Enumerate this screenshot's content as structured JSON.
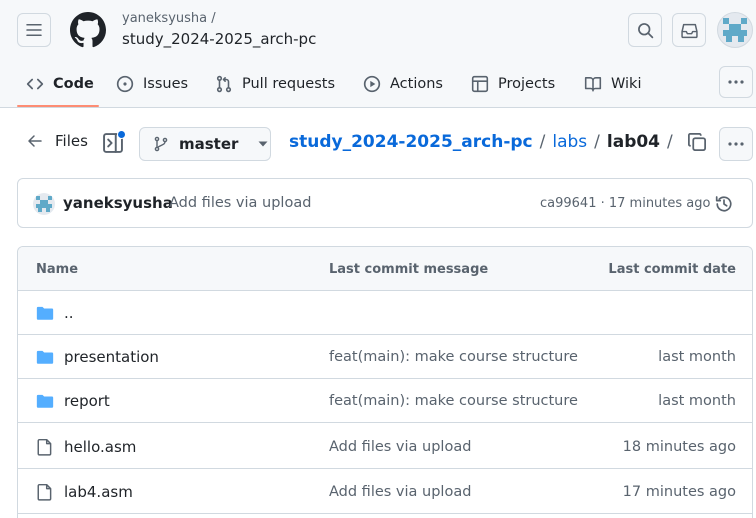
{
  "header": {
    "owner": "yaneksyusha /",
    "repo": "study_2024-2025_arch-pc",
    "menu_icon": "hamburger-icon",
    "logo_icon": "github-logo",
    "search_icon": "search-icon",
    "inbox_icon": "inbox-icon"
  },
  "nav": {
    "items": [
      {
        "label": "Code",
        "icon": "code-icon"
      },
      {
        "label": "Issues",
        "icon": "issue-opened-icon"
      },
      {
        "label": "Pull requests",
        "icon": "git-pull-request-icon"
      },
      {
        "label": "Actions",
        "icon": "play-icon"
      },
      {
        "label": "Projects",
        "icon": "table-icon"
      },
      {
        "label": "Wiki",
        "icon": "book-icon"
      }
    ],
    "active": "Code"
  },
  "path_bar": {
    "files_label": "Files",
    "branch": "master",
    "breadcrumb": {
      "repo": "study_2024-2025_arch-pc",
      "sep1": "/",
      "folder": "labs",
      "sep2": "/",
      "current": "lab04",
      "sep3": "/"
    }
  },
  "commit": {
    "author": "yaneksyusha",
    "message": "Add files via upload",
    "meta": "ca99641 · 17 minutes ago"
  },
  "table": {
    "headers": {
      "name": "Name",
      "message": "Last commit message",
      "date": "Last commit date"
    },
    "rows": [
      {
        "type": "folder",
        "name": "..",
        "message": "",
        "date": ""
      },
      {
        "type": "folder",
        "name": "presentation",
        "message": "feat(main): make course structure",
        "date": "last month"
      },
      {
        "type": "folder",
        "name": "report",
        "message": "feat(main): make course structure",
        "date": "last month"
      },
      {
        "type": "file",
        "name": "hello.asm",
        "message": "Add files via upload",
        "date": "18 minutes ago"
      },
      {
        "type": "file",
        "name": "lab4.asm",
        "message": "Add files via upload",
        "date": "17 minutes ago"
      }
    ]
  },
  "colors": {
    "link": "#0969da",
    "folder": "#54aeff",
    "active_underline": "#fd8c73",
    "muted": "#59636e",
    "border": "#d1d9e0"
  }
}
